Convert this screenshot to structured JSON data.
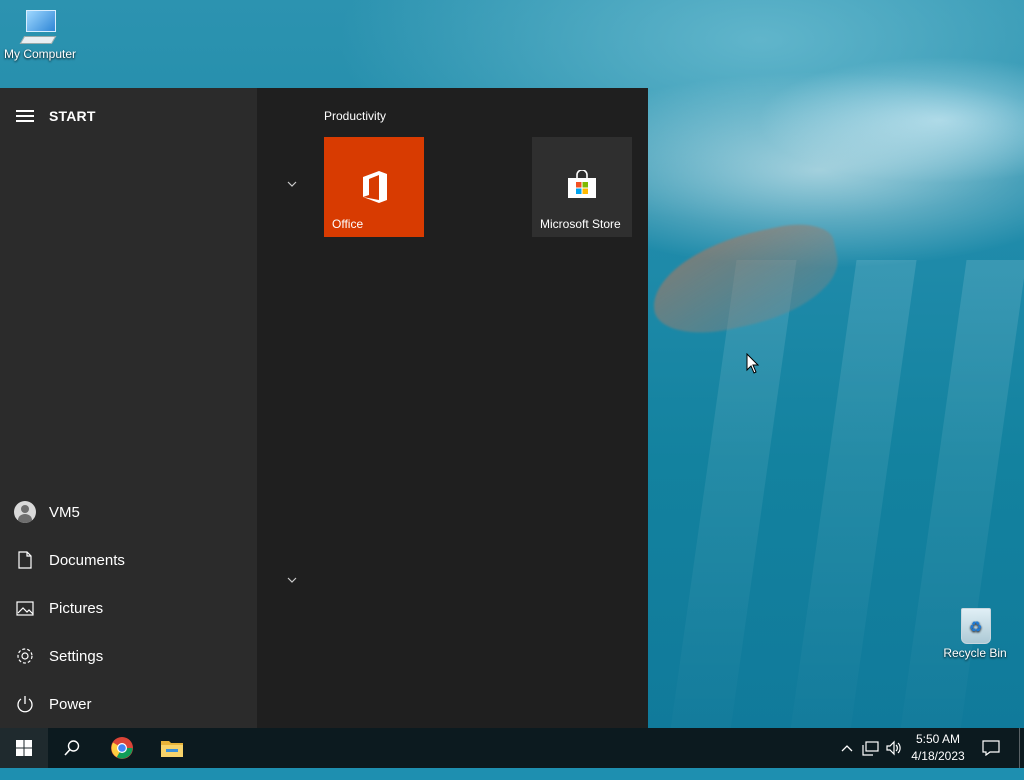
{
  "desktop": {
    "icons": [
      {
        "label": "My Computer",
        "icon": "computer-icon"
      },
      {
        "label": "Recycle Bin",
        "icon": "recycle-bin-icon"
      }
    ]
  },
  "start_menu": {
    "title": "START",
    "left_items": [
      {
        "label": "VM5",
        "icon": "user-avatar-icon"
      },
      {
        "label": "Documents",
        "icon": "document-icon"
      },
      {
        "label": "Pictures",
        "icon": "pictures-icon"
      },
      {
        "label": "Settings",
        "icon": "gear-icon"
      },
      {
        "label": "Power",
        "icon": "power-icon"
      }
    ],
    "group_label": "Productivity",
    "tiles": [
      {
        "label": "Office",
        "icon": "office-icon",
        "color": "#d83b01"
      },
      {
        "label": "Microsoft Store",
        "icon": "store-bag-icon",
        "color": "#2f2f2f"
      }
    ]
  },
  "taskbar": {
    "pinned": [
      {
        "name": "search",
        "icon": "search-icon"
      },
      {
        "name": "chrome",
        "icon": "chrome-icon"
      },
      {
        "name": "file-explorer",
        "icon": "folder-icon"
      }
    ],
    "clock": {
      "time": "5:50 AM",
      "date": "4/18/2023"
    },
    "tray_icons": [
      "chevron-up-icon",
      "network-icon",
      "volume-icon",
      "notification-icon"
    ]
  }
}
